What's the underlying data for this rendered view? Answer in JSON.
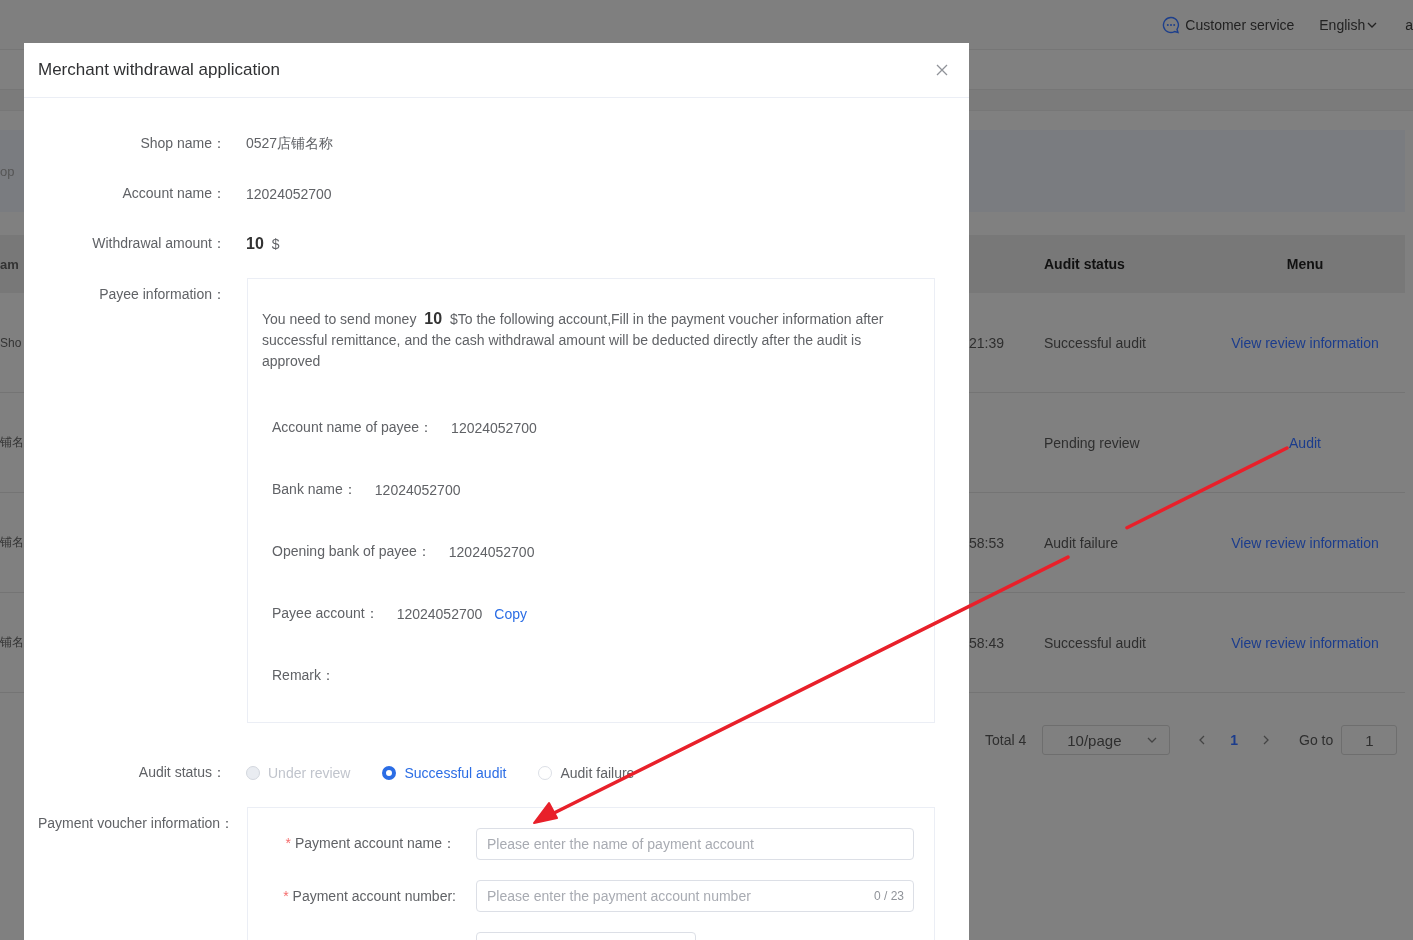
{
  "header": {
    "customer_service": "Customer service",
    "language": "English",
    "account_fragment": "a"
  },
  "filter": {
    "field_fragment": "op"
  },
  "table": {
    "columns": [
      "am",
      "Audit status",
      "Menu"
    ],
    "rows": [
      {
        "name_fragment": "Sho",
        "time_fragment": "21:39",
        "audit_status": "Successful audit",
        "action": "View review information"
      },
      {
        "name_fragment": "铺名",
        "audit_status": "Pending review",
        "action": "Audit"
      },
      {
        "name_fragment": "铺名",
        "time_fragment": "58:53",
        "audit_status": "Audit failure",
        "action": "View review information"
      },
      {
        "name_fragment": "铺名",
        "time_fragment": "58:43",
        "audit_status": "Successful audit",
        "action": "View review information"
      }
    ]
  },
  "pagination": {
    "total": "Total 4",
    "page_size": "10/page",
    "pages": [
      {
        "label": "1",
        "selected": true
      }
    ],
    "goto_label": "Go to",
    "goto_value": "1"
  },
  "modal": {
    "title": "Merchant withdrawal application",
    "details": [
      {
        "kind": "text",
        "label": "Shop name：",
        "value": "0527店铺名称"
      },
      {
        "kind": "text",
        "label": "Account name：",
        "value": "12024052700"
      },
      {
        "kind": "amount",
        "label": "Withdrawal amount：",
        "amount": "10",
        "currency": "$"
      }
    ],
    "payee_label": "Payee information：",
    "payee_notice": "You need to send money **10** $To the following account,Fill in the payment voucher information after successful remittance, and the cash withdrawal amount will be deducted directly after the audit is approved",
    "payee_rows": [
      {
        "label": "Account name of payee：",
        "value": "12024052700"
      },
      {
        "label": "Bank name：",
        "value": "12024052700"
      },
      {
        "label": "Opening bank of payee：",
        "value": "12024052700"
      },
      {
        "label": "Payee account：",
        "value": "12024052700",
        "action": "Copy"
      },
      {
        "label": "Remark："
      }
    ],
    "audit_label": "Audit status：",
    "audit_options": [
      {
        "label": "Under review",
        "selected": false,
        "disabled": true
      },
      {
        "label": "Successful audit",
        "selected": true,
        "disabled": false
      },
      {
        "label": "Audit failure",
        "selected": false,
        "disabled": false
      }
    ],
    "voucher_label": "Payment voucher information：",
    "voucher_fields": [
      {
        "required_mark": "*",
        "label": "Payment account name：",
        "placeholder": "Please enter the name of payment account"
      },
      {
        "required_mark": "*",
        "label": "Payment account number:",
        "placeholder": "Please enter the payment account number",
        "counter": "0 / 23"
      }
    ]
  }
}
